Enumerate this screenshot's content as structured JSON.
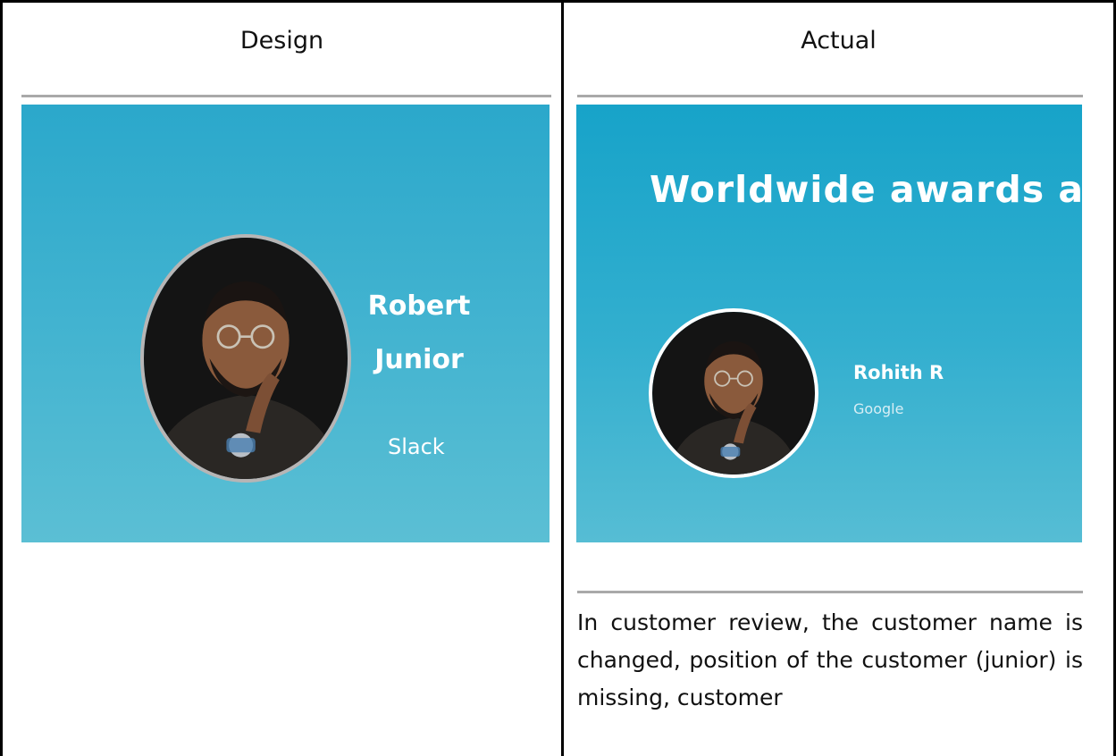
{
  "table": {
    "header_design": "Design",
    "header_actual": "Actual"
  },
  "design": {
    "name_line1": "Robert",
    "name_line2": "Junior",
    "company": "Slack"
  },
  "actual": {
    "heading": "Worldwide awards anc",
    "name": "Rohith R",
    "company": "Google"
  },
  "note": "In customer review, the customer name is changed, position of the customer (junior) is missing, customer"
}
